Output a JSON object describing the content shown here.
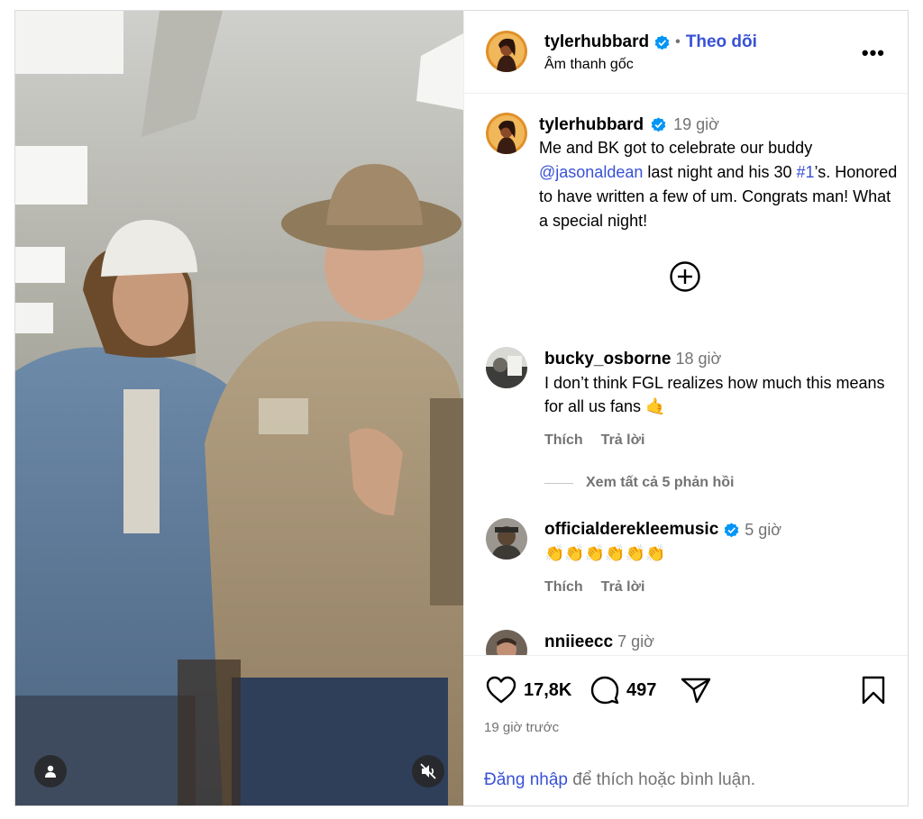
{
  "post": {
    "author": "tylerhubbard",
    "follow_label": "Theo dõi",
    "audio": "Âm thanh gốc",
    "more": "•••"
  },
  "caption": {
    "author": "tylerhubbard",
    "time": "19 giờ",
    "text_1": "Me and BK got to celebrate our buddy",
    "mention": "@jasonaldean",
    "text_2": " last night and his 30 ",
    "hashtag": "#1",
    "text_3": "’s. Honored to have written a few of um. Congrats man! What a special night!"
  },
  "comments": [
    {
      "user": "bucky_osborne",
      "verified": false,
      "time": "18 giờ",
      "text": "I don’t think FGL realizes how much this means for all us fans 🤙",
      "like": "Thích",
      "reply": "Trả lời"
    },
    {
      "user": "officialderekleemusic",
      "verified": true,
      "time": "5 giờ",
      "text": "👏👏👏👏👏👏",
      "like": "Thích",
      "reply": "Trả lời"
    },
    {
      "user": "nniieecc",
      "verified": false,
      "time": "7 giờ",
      "text": "❤️🔥"
    }
  ],
  "view_replies": "Xem tất cả 5 phản hồi",
  "actions": {
    "likes": "17,8K",
    "comments": "497"
  },
  "posted_ago": "19 giờ trước",
  "login_prompt": {
    "link": "Đăng nhập",
    "rest": " để thích hoặc bình luận."
  },
  "colors": {
    "link_blue": "#3851d6",
    "verified_blue": "#0095f6",
    "muted_gray": "#737373"
  },
  "icons": [
    "user-icon",
    "mute-icon",
    "verified-icon",
    "more-icon",
    "add-icon",
    "heart-icon",
    "comment-icon",
    "share-icon",
    "bookmark-icon"
  ]
}
